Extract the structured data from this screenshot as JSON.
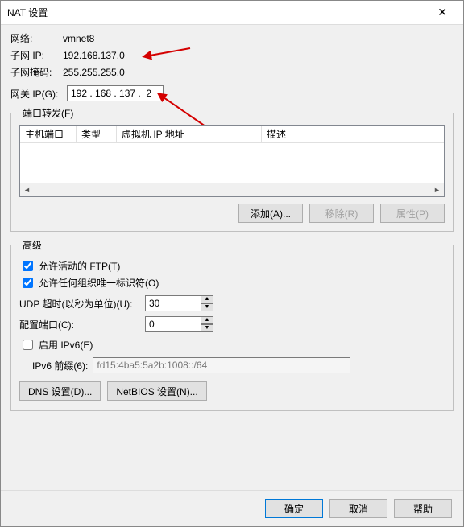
{
  "title": "NAT 设置",
  "network": {
    "label": "网络:",
    "value": "vmnet8"
  },
  "subnet_ip": {
    "label": "子网 IP:",
    "value": "192.168.137.0"
  },
  "subnet_mask": {
    "label": "子网掩码:",
    "value": "255.255.255.0"
  },
  "gateway": {
    "label": "网关 IP(G):",
    "value": "192 . 168 . 137 .  2"
  },
  "port_forward": {
    "legend": "端口转发(F)",
    "columns": {
      "host_port": "主机端口",
      "type": "类型",
      "vm_ip": "虚拟机 IP 地址",
      "desc": "描述"
    },
    "buttons": {
      "add": "添加(A)...",
      "remove": "移除(R)",
      "props": "属性(P)"
    }
  },
  "advanced": {
    "legend": "高级",
    "allow_ftp": "允许活动的 FTP(T)",
    "allow_oui": "允许任何组织唯一标识符(O)",
    "udp_timeout": {
      "label": "UDP 超时(以秒为单位)(U):",
      "value": "30"
    },
    "config_port": {
      "label": "配置端口(C):",
      "value": "0"
    },
    "enable_ipv6": "启用 IPv6(E)",
    "ipv6_prefix": {
      "label": "IPv6 前缀(6):",
      "value": "fd15:4ba5:5a2b:1008::/64"
    },
    "buttons": {
      "dns": "DNS 设置(D)...",
      "netbios": "NetBIOS 设置(N)..."
    }
  },
  "footer": {
    "ok": "确定",
    "cancel": "取消",
    "help": "帮助"
  },
  "checked": {
    "allow_ftp": true,
    "allow_oui": true,
    "enable_ipv6": false
  }
}
